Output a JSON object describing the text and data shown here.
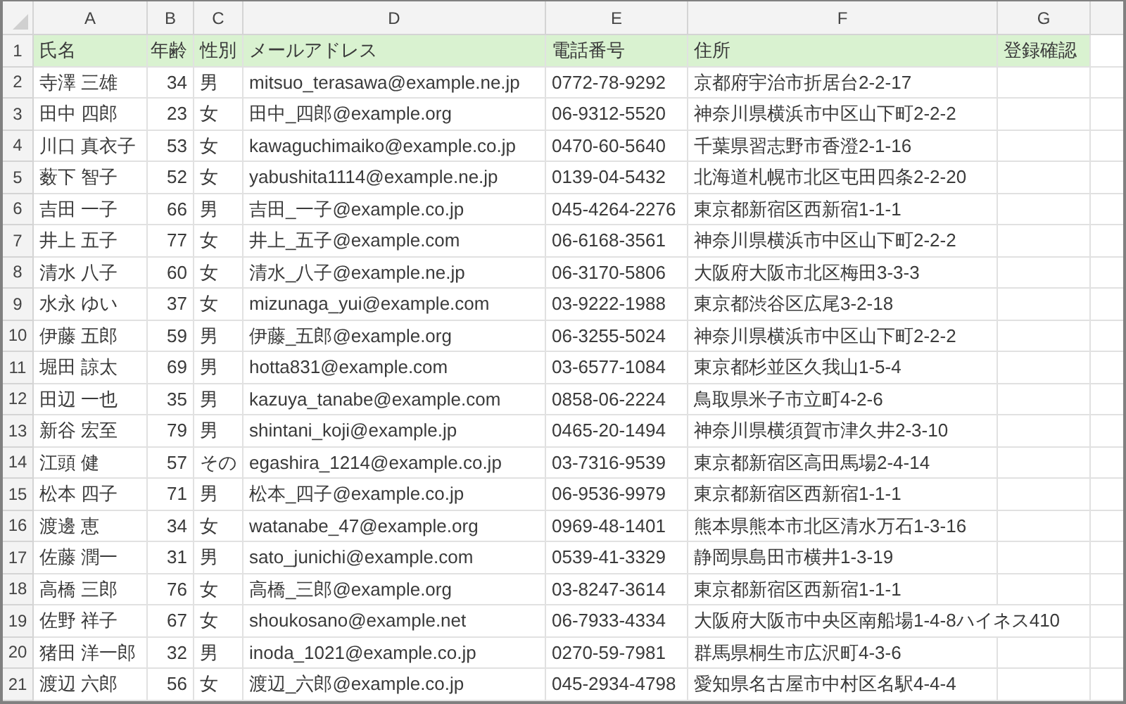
{
  "column_headers": [
    "A",
    "B",
    "C",
    "D",
    "E",
    "F",
    "G"
  ],
  "rows": [
    {
      "number": "1",
      "kind": "header",
      "cells": [
        "氏名",
        "年齢",
        "性別",
        "メールアドレス",
        "電話番号",
        "住所",
        "登録確認"
      ]
    },
    {
      "number": "2",
      "kind": "data",
      "cells": [
        "寺澤 三雄",
        "34",
        "男",
        "mitsuo_terasawa@example.ne.jp",
        "0772-78-9292",
        "京都府宇治市折居台2-2-17"
      ]
    },
    {
      "number": "3",
      "kind": "data",
      "cells": [
        "田中 四郎",
        "23",
        "女",
        "田中_四郎@example.org",
        "06-9312-5520",
        "神奈川県横浜市中区山下町2-2-2"
      ]
    },
    {
      "number": "4",
      "kind": "data",
      "cells": [
        "川口 真衣子",
        "53",
        "女",
        "kawaguchimaiko@example.co.jp",
        "0470-60-5640",
        "千葉県習志野市香澄2-1-16"
      ]
    },
    {
      "number": "5",
      "kind": "data",
      "cells": [
        "薮下 智子",
        "52",
        "女",
        "yabushita1114@example.ne.jp",
        "0139-04-5432",
        "北海道札幌市北区屯田四条2-2-20"
      ]
    },
    {
      "number": "6",
      "kind": "data",
      "cells": [
        "吉田 一子",
        "66",
        "男",
        "吉田_一子@example.co.jp",
        "045-4264-2276",
        "東京都新宿区西新宿1-1-1"
      ]
    },
    {
      "number": "7",
      "kind": "data",
      "cells": [
        "井上 五子",
        "77",
        "女",
        "井上_五子@example.com",
        "06-6168-3561",
        "神奈川県横浜市中区山下町2-2-2"
      ]
    },
    {
      "number": "8",
      "kind": "data",
      "cells": [
        "清水 八子",
        "60",
        "女",
        "清水_八子@example.ne.jp",
        "06-3170-5806",
        "大阪府大阪市北区梅田3-3-3"
      ]
    },
    {
      "number": "9",
      "kind": "data",
      "cells": [
        "水永 ゆい",
        "37",
        "女",
        "mizunaga_yui@example.com",
        "03-9222-1988",
        "東京都渋谷区広尾3-2-18"
      ]
    },
    {
      "number": "10",
      "kind": "data",
      "cells": [
        "伊藤 五郎",
        "59",
        "男",
        "伊藤_五郎@example.org",
        "06-3255-5024",
        "神奈川県横浜市中区山下町2-2-2"
      ]
    },
    {
      "number": "11",
      "kind": "data",
      "cells": [
        "堀田 諒太",
        "69",
        "男",
        "hotta831@example.com",
        "03-6577-1084",
        "東京都杉並区久我山1-5-4"
      ]
    },
    {
      "number": "12",
      "kind": "data",
      "cells": [
        "田辺 一也",
        "35",
        "男",
        "kazuya_tanabe@example.com",
        "0858-06-2224",
        "鳥取県米子市立町4-2-6"
      ]
    },
    {
      "number": "13",
      "kind": "data",
      "cells": [
        "新谷 宏至",
        "79",
        "男",
        "shintani_koji@example.jp",
        "0465-20-1494",
        "神奈川県横須賀市津久井2-3-10"
      ]
    },
    {
      "number": "14",
      "kind": "data",
      "cells": [
        "江頭 健",
        "57",
        "その",
        "egashira_1214@example.co.jp",
        "03-7316-9539",
        "東京都新宿区高田馬場2-4-14"
      ]
    },
    {
      "number": "15",
      "kind": "data",
      "cells": [
        "松本 四子",
        "71",
        "男",
        "松本_四子@example.co.jp",
        "06-9536-9979",
        "東京都新宿区西新宿1-1-1"
      ]
    },
    {
      "number": "16",
      "kind": "data",
      "cells": [
        "渡邊 恵",
        "34",
        "女",
        "watanabe_47@example.org",
        "0969-48-1401",
        "熊本県熊本市北区清水万石1-3-16"
      ]
    },
    {
      "number": "17",
      "kind": "data",
      "cells": [
        "佐藤 潤一",
        "31",
        "男",
        "sato_junichi@example.com",
        "0539-41-3329",
        "静岡県島田市横井1-3-19"
      ]
    },
    {
      "number": "18",
      "kind": "data",
      "cells": [
        "高橋 三郎",
        "76",
        "女",
        "高橋_三郎@example.org",
        "03-8247-3614",
        "東京都新宿区西新宿1-1-1"
      ]
    },
    {
      "number": "19",
      "kind": "data",
      "cells": [
        "佐野 祥子",
        "67",
        "女",
        "shoukosano@example.net",
        "06-7933-4334",
        "大阪府大阪市中央区南船場1-4-8ハイネス410"
      ]
    },
    {
      "number": "20",
      "kind": "data",
      "cells": [
        "猪田 洋一郎",
        "32",
        "男",
        "inoda_1021@example.co.jp",
        "0270-59-7981",
        "群馬県桐生市広沢町4-3-6"
      ]
    },
    {
      "number": "21",
      "kind": "data",
      "cells": [
        "渡辺 六郎",
        "56",
        "女",
        "渡辺_六郎@example.co.jp",
        "045-2934-4798",
        "愛知県名古屋市中村区名駅4-4-4"
      ]
    }
  ]
}
